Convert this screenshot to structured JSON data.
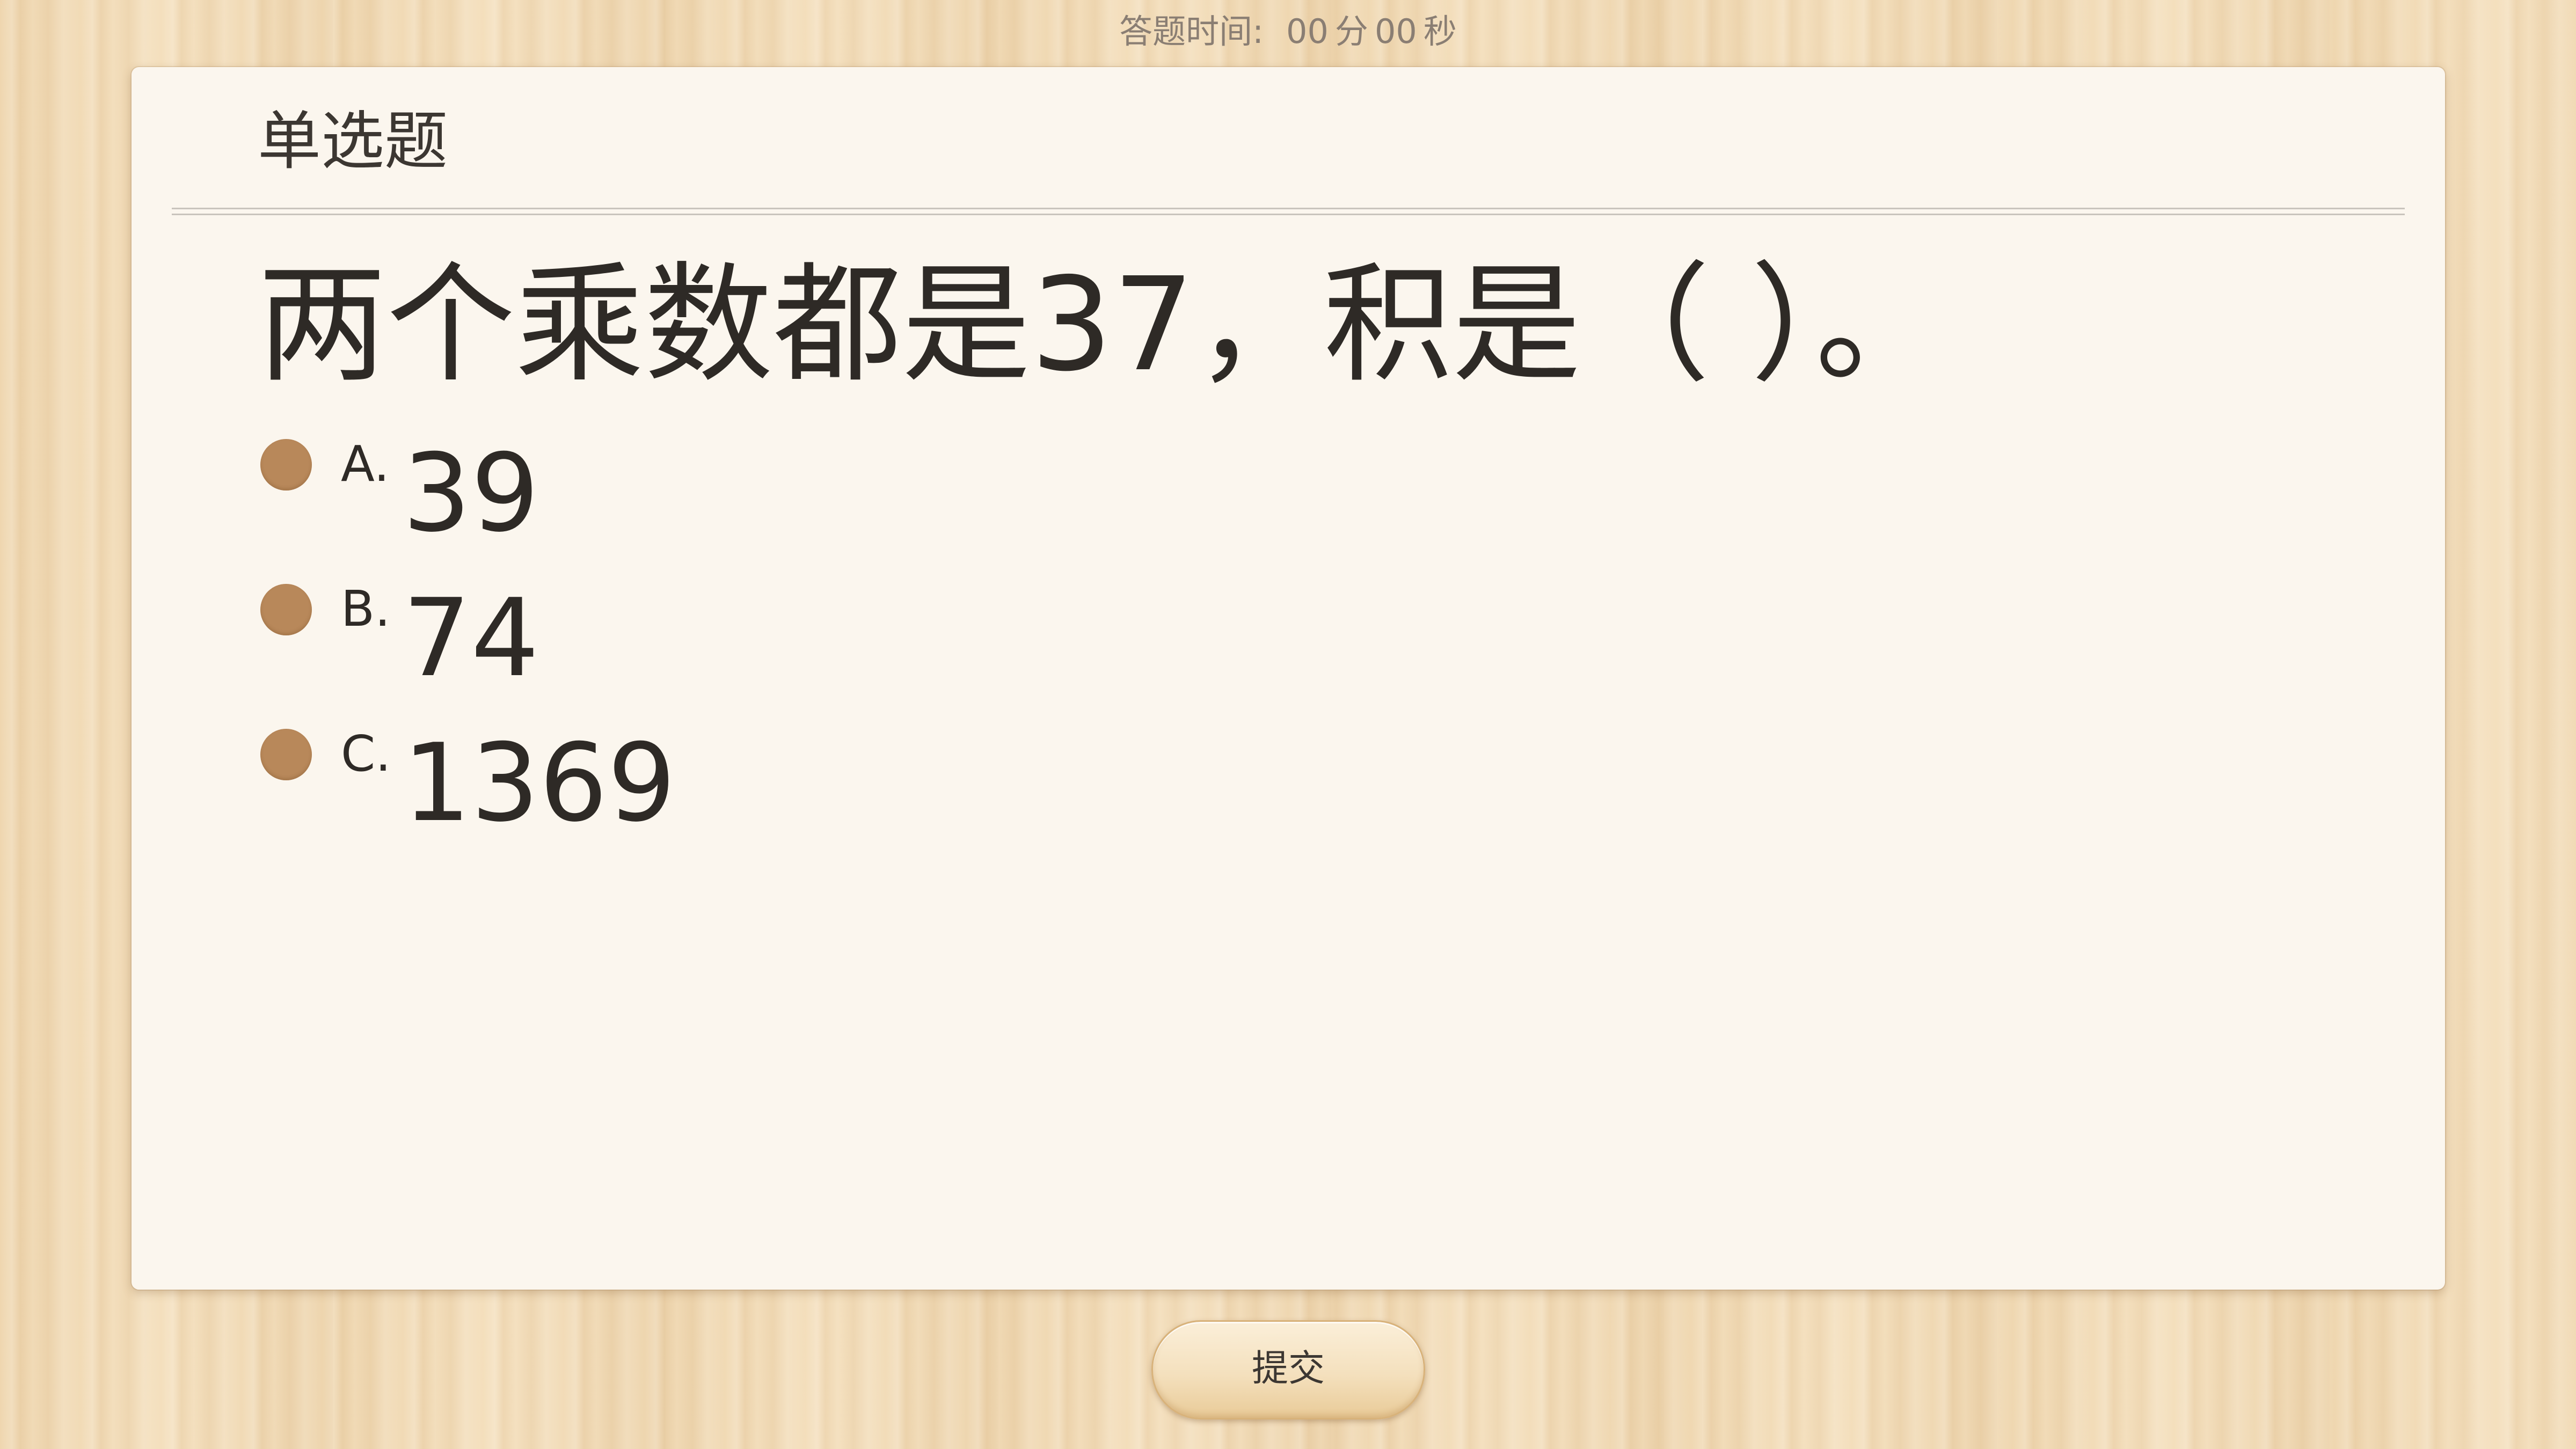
{
  "timer": {
    "label": "答题时间:",
    "minutes": "00",
    "minutes_unit": "分",
    "seconds": "00",
    "seconds_unit": "秒"
  },
  "question": {
    "type": "单选题",
    "text": "两个乘数都是37，积是（    ）。",
    "options": [
      {
        "letter": "A.",
        "value": "39"
      },
      {
        "letter": "B.",
        "value": "74"
      },
      {
        "letter": "C.",
        "value": "1369"
      }
    ]
  },
  "submit": {
    "label": "提交"
  },
  "colors": {
    "background_wood": "#f3dcb6",
    "card": "#fbf6ee",
    "radio": "#b8885a",
    "text": "#2e2a26"
  }
}
